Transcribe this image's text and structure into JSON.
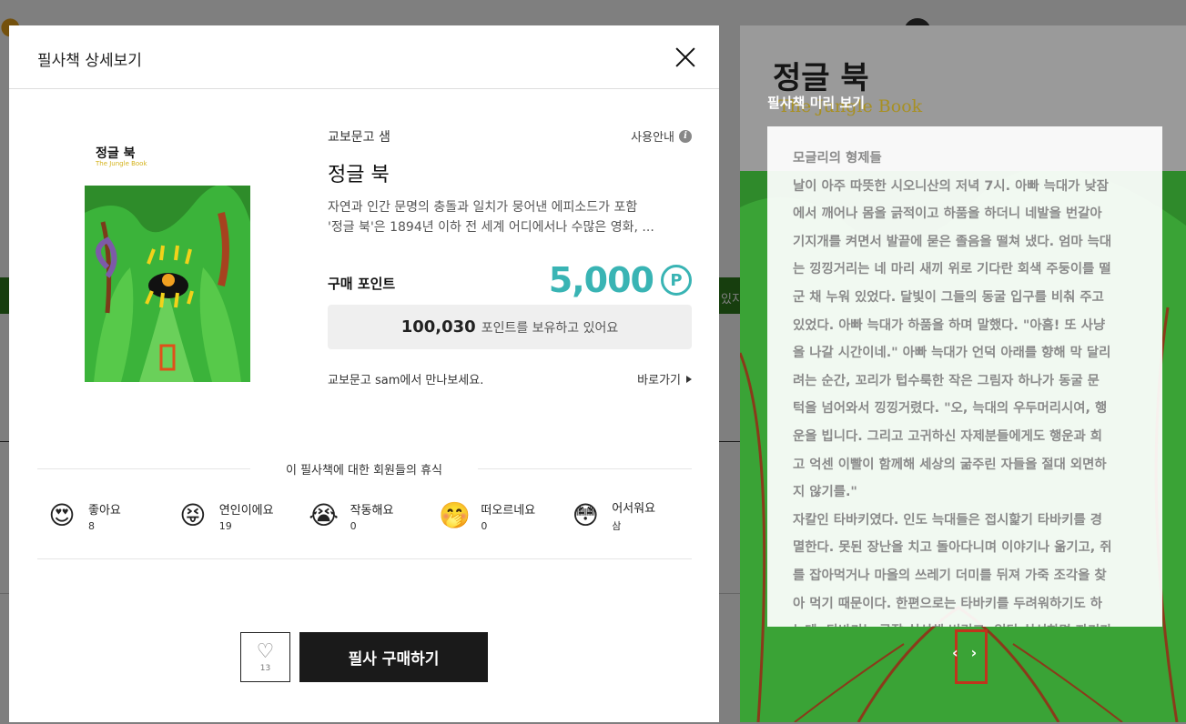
{
  "modal": {
    "title": "필사책 상세보기",
    "publisher": "교보문고 샘",
    "guide_label": "사용안내",
    "book_title": "정글 북",
    "description_lines": [
      "자연과 인간 문명의 충돌과 일치가 뭉어낸 에피소드가 포함",
      "'정글 북'은 1894년 이하 전 세계 어디에서나 수많은 영화, ..."
    ],
    "price_label": "구매 포인트",
    "price_value": "5,000",
    "point_symbol": "P",
    "points_owned": "100,030",
    "points_owned_suffix": "포인트를 보유하고 있어요",
    "meet_text": "교보문고 sam에서 만나보세요.",
    "goto_label": "바로가기",
    "reactions_title": "이 필사책에 대한 회원들의 휴식",
    "reactions": [
      {
        "label": "좋아요",
        "count": "8",
        "emoji": "😍"
      },
      {
        "label": "연인이에요",
        "count": "19",
        "emoji": "😝"
      },
      {
        "label": "작동해요",
        "count": "0",
        "emoji": "😭"
      },
      {
        "label": "떠오르네요",
        "count": "0",
        "emoji": "🤭"
      },
      {
        "label": "어서워요",
        "count": "삼",
        "emoji": "😳"
      }
    ],
    "like_count": "13",
    "buy_label": "필사 구매하기"
  },
  "cover": {
    "title": "정글 북",
    "subtitle": "The Jungle Book"
  },
  "preview": {
    "book_title": "정글 북",
    "book_subtitle": "The Jungle Book",
    "label": "필사책 미리 보기",
    "lines": [
      "모글리의 형제들",
      "날이 아주 따뜻한 시오니산의 저녁 7시. 아빠 늑대가 낮잠",
      "에서 깨어나 몸을 긁적이고 하품을 하더니 네발을 번갈아",
      "기지개를 켜면서 발끝에 묻은 졸음을 떨쳐 냈다. 엄마 늑대",
      "는 낑낑거리는 네 마리 새끼 위로 기다란 회색 주둥이를 떨",
      "군 채 누워 있었다. 달빛이 그들의 동굴 입구를 비춰 주고",
      "있었다. 아빠 늑대가 하품을 하며 말했다. \"아흠! 또 사냥",
      "을 나갈 시간이네.\" 아빠 늑대가 언덕 아래를 향해 막 달리",
      "려는 순간, 꼬리가 텁수룩한 작은 그림자 하나가 동굴 문",
      "턱을 넘어와서 낑낑거렸다. \"오, 늑대의 우두머리시여, 행",
      "운을 빕니다. 그리고 고귀하신 자제분들에게도 행운과 희",
      "고 억센 이빨이 함께해 세상의 굶주린 자들을 절대 외면하",
      "지 않기를.\"",
      "자칼인 타바키였다. 인도 늑대들은 접시핥기 타바키를 경",
      "멸한다. 못된 장난을 치고 돌아다니며 이야기나 옮기고, 쥐",
      "를 잡아먹거나 마을의 쓰레기 더미를 뒤져 가죽 조각을 찾",
      "아 먹기 때문이다. 한편으로는 타바키를 두려워하기도 하",
      "는데, 타바키는 곧잘 실성해 버리고, 일단 실성하면 자기가"
    ],
    "prev_label": "‹",
    "next_label": "›"
  },
  "background": {
    "right_text": "있지"
  },
  "colors": {
    "accent": "#39b4b4",
    "buy_button": "#1a1a1a",
    "jungle_green": "#3bb33a"
  }
}
